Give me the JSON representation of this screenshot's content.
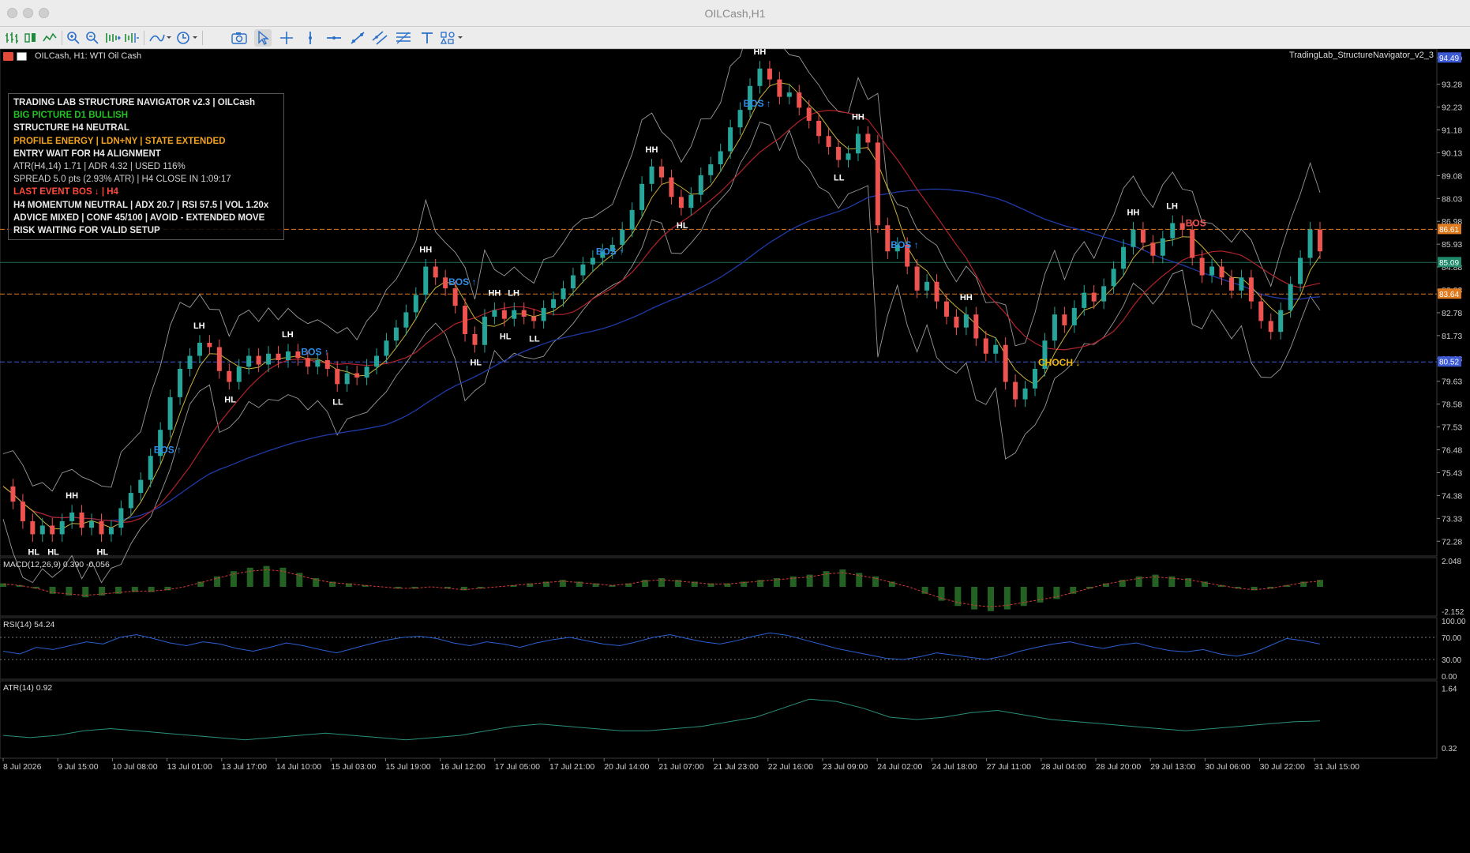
{
  "window": {
    "title": "OILCash,H1"
  },
  "toolbar": {
    "icons": [
      "chart-bars-icon",
      "candles-icon",
      "line-chart-icon",
      "zoom-in-icon",
      "zoom-out-icon",
      "autoscroll-icon",
      "chart-shift-icon",
      "indicators-icon",
      "periods-icon",
      "screenshot-icon",
      "cursor-icon",
      "crosshair-icon",
      "vertical-line-icon",
      "horizontal-line-icon",
      "trendline-icon",
      "channel-icon",
      "fibonacci-icon",
      "text-icon",
      "shapes-icon"
    ]
  },
  "chart": {
    "symbol_label": "OILCash, H1:  WTI Oil Cash",
    "indicator_name": "TradingLab_StructureNavigator_v2_3",
    "colors": {
      "bull": "#26a69a",
      "bear": "#ef5350",
      "bos": "#2f8fe8",
      "choch": "#f2b705",
      "orange_level": "#e07a1f",
      "ma_blue": "#1f3aa8",
      "ma_red": "#b2222a"
    },
    "price_axis": [
      "94.49",
      "93.28",
      "92.23",
      "91.18",
      "90.13",
      "89.08",
      "88.03",
      "86.98",
      "85.93",
      "84.88",
      "83.83",
      "82.78",
      "81.73",
      "80.68",
      "79.63",
      "78.58",
      "77.53",
      "76.48",
      "75.43",
      "74.38",
      "73.33",
      "72.28"
    ],
    "price_tags": [
      {
        "label": "94.49",
        "color": "#3d5ad6"
      },
      {
        "label": "86.61",
        "color": "#e07a1f"
      },
      {
        "label": "85.09",
        "color": "#1f8a6a"
      },
      {
        "label": "83.64",
        "color": "#e07a1f"
      },
      {
        "label": "80.52",
        "color": "#3d5ad6"
      }
    ],
    "time_axis": [
      "8 Jul 2026",
      "9 Jul 15:00",
      "10 Jul 08:00",
      "13 Jul 01:00",
      "13 Jul 17:00",
      "14 Jul 10:00",
      "15 Jul 03:00",
      "15 Jul 19:00",
      "16 Jul 12:00",
      "17 Jul 05:00",
      "17 Jul 21:00",
      "20 Jul 14:00",
      "21 Jul 07:00",
      "21 Jul 23:00",
      "22 Jul 16:00",
      "23 Jul 09:00",
      "24 Jul 02:00",
      "24 Jul 18:00",
      "27 Jul 11:00",
      "28 Jul 04:00",
      "28 Jul 20:00",
      "29 Jul 13:00",
      "30 Jul 06:00",
      "30 Jul 22:00",
      "31 Jul 15:00"
    ],
    "labels": [
      {
        "text": "HH",
        "kind": "white"
      },
      {
        "text": "LH",
        "kind": "white"
      },
      {
        "text": "LH",
        "kind": "white"
      },
      {
        "text": "HH",
        "kind": "white"
      },
      {
        "text": "HH",
        "kind": "white"
      },
      {
        "text": "LH",
        "kind": "white"
      },
      {
        "text": "HH",
        "kind": "white"
      },
      {
        "text": "HH",
        "kind": "white"
      },
      {
        "text": "HH",
        "kind": "white"
      },
      {
        "text": "HH",
        "kind": "white"
      },
      {
        "text": "HH",
        "kind": "white"
      },
      {
        "text": "LH",
        "kind": "white"
      },
      {
        "text": "HL",
        "kind": "white"
      },
      {
        "text": "HL",
        "kind": "white"
      },
      {
        "text": "HL",
        "kind": "white"
      },
      {
        "text": "HL",
        "kind": "white"
      },
      {
        "text": "LL",
        "kind": "white"
      },
      {
        "text": "HL",
        "kind": "white"
      },
      {
        "text": "HL",
        "kind": "white"
      },
      {
        "text": "LL",
        "kind": "white"
      },
      {
        "text": "HL",
        "kind": "white"
      },
      {
        "text": "LL",
        "kind": "white"
      },
      {
        "text": "BOS ↑",
        "kind": "bos"
      },
      {
        "text": "BOS ↑",
        "kind": "bos"
      },
      {
        "text": "BOS ↑",
        "kind": "bos"
      },
      {
        "text": "BOS ↑",
        "kind": "bos"
      },
      {
        "text": "BOS ↑",
        "kind": "bos"
      },
      {
        "text": "BOS ↑",
        "kind": "bos"
      },
      {
        "text": "CHOCH ↓",
        "kind": "choch"
      },
      {
        "text": "BOS",
        "kind": "bear"
      }
    ]
  },
  "dashboard": {
    "lines": [
      {
        "text": "TRADING LAB STRUCTURE NAVIGATOR v2.3  |  OILCash",
        "color": "w"
      },
      {
        "text": "BIG PICTURE D1   BULLISH",
        "color": "g"
      },
      {
        "text": "STRUCTURE   H4   NEUTRAL",
        "color": "w"
      },
      {
        "text": "PROFILE ENERGY   |   LDN+NY   |   STATE EXTENDED",
        "color": "o"
      },
      {
        "text": "ENTRY   WAIT FOR H4 ALIGNMENT",
        "color": "w"
      },
      {
        "text": "ATR(H4,14)  1.71   |   ADR  4.32   |   USED 116%",
        "color": "n"
      },
      {
        "text": "SPREAD  5.0 pts  (2.93% ATR)   |   H4 CLOSE IN  1:09:17",
        "color": "n"
      },
      {
        "text": "LAST EVENT  BOS ↓ | H4",
        "color": "r"
      },
      {
        "text": "H4 MOMENTUM NEUTRAL   | ADX 20.7 | RSI 57.5 | VOL 1.20x",
        "color": "w"
      },
      {
        "text": "ADVICE MIXED   |   CONF 45/100   |   AVOID - EXTENDED MOVE",
        "color": "w"
      },
      {
        "text": "RISK   WAITING FOR VALID SETUP",
        "color": "w"
      }
    ]
  },
  "macd": {
    "label": "MACD(12,26,9) 0.390 -0.056",
    "axis": [
      "2.048",
      "-2.152"
    ]
  },
  "rsi": {
    "label": "RSI(14) 54.24",
    "axis": [
      "100.00",
      "70.00",
      "30.00",
      "0.00"
    ]
  },
  "atr": {
    "label": "ATR(14) 0.92",
    "axis": [
      "1.64",
      "0.32"
    ]
  },
  "series_path": [
    74.8,
    74.1,
    73.2,
    72.6,
    73.0,
    72.6,
    73.2,
    73.6,
    72.9,
    73.2,
    72.6,
    72.9,
    73.8,
    74.5,
    75.1,
    76.2,
    77.4,
    78.9,
    80.2,
    80.8,
    81.4,
    81.2,
    80.1,
    79.6,
    80.3,
    80.8,
    80.4,
    80.9,
    80.6,
    81.0,
    80.7,
    80.3,
    80.6,
    80.2,
    79.5,
    80.0,
    79.8,
    80.3,
    80.8,
    81.5,
    82.1,
    82.8,
    83.6,
    84.9,
    84.4,
    83.9,
    83.1,
    81.8,
    81.3,
    82.6,
    82.9,
    82.5,
    82.9,
    82.6,
    82.4,
    83.0,
    83.4,
    83.9,
    84.5,
    85.0,
    85.3,
    85.6,
    85.9,
    86.6,
    87.5,
    88.7,
    89.5,
    89.0,
    88.1,
    87.6,
    88.2,
    89.1,
    89.6,
    90.2,
    91.3,
    92.1,
    93.2,
    94.0,
    93.5,
    92.7,
    92.9,
    92.2,
    91.6,
    90.9,
    90.4,
    89.8,
    90.1,
    91.0,
    90.6,
    86.8,
    85.6,
    85.9,
    84.9,
    83.8,
    84.2,
    83.3,
    82.6,
    82.1,
    82.7,
    81.6,
    80.9,
    81.3,
    79.6,
    78.8,
    79.3,
    80.2,
    81.5,
    82.7,
    82.2,
    83.0,
    83.7,
    83.3,
    84.0,
    84.8,
    85.8,
    86.6,
    86.0,
    85.4,
    86.2,
    86.9,
    86.6,
    85.3,
    84.5,
    84.9,
    84.4,
    83.8,
    84.4,
    83.3,
    82.4,
    81.9,
    82.9,
    84.1,
    85.3,
    86.6,
    85.6
  ],
  "macd_path": [
    0.2,
    0.1,
    -0.1,
    -0.4,
    -0.5,
    -0.6,
    -0.5,
    -0.4,
    -0.3,
    -0.3,
    -0.2,
    0.0,
    0.3,
    0.6,
    0.9,
    1.1,
    1.2,
    1.1,
    0.8,
    0.5,
    0.3,
    0.2,
    0.1,
    0.0,
    -0.1,
    -0.1,
    0.0,
    -0.1,
    -0.2,
    -0.1,
    0.0,
    0.1,
    0.2,
    0.3,
    0.4,
    0.3,
    0.2,
    0.1,
    0.2,
    0.4,
    0.5,
    0.4,
    0.3,
    0.2,
    0.2,
    0.3,
    0.4,
    0.5,
    0.6,
    0.7,
    0.9,
    1.0,
    0.8,
    0.6,
    0.3,
    0.0,
    -0.4,
    -0.8,
    -1.1,
    -1.3,
    -1.4,
    -1.3,
    -1.1,
    -0.9,
    -0.7,
    -0.4,
    -0.1,
    0.2,
    0.4,
    0.6,
    0.7,
    0.6,
    0.5,
    0.3,
    0.1,
    -0.1,
    -0.2,
    -0.1,
    0.1,
    0.3,
    0.4
  ],
  "rsi_path": [
    45,
    40,
    52,
    48,
    55,
    62,
    58,
    70,
    75,
    68,
    60,
    55,
    62,
    58,
    50,
    45,
    52,
    60,
    55,
    48,
    42,
    50,
    58,
    65,
    70,
    72,
    68,
    60,
    55,
    62,
    58,
    52,
    60,
    66,
    70,
    64,
    58,
    55,
    62,
    70,
    75,
    68,
    62,
    58,
    64,
    72,
    78,
    74,
    66,
    58,
    50,
    44,
    38,
    32,
    30,
    35,
    42,
    38,
    34,
    30,
    36,
    45,
    52,
    58,
    62,
    55,
    50,
    56,
    60,
    52,
    46,
    44,
    48,
    40,
    36,
    42,
    55,
    68,
    64,
    58
  ],
  "atr_path": [
    0.6,
    0.55,
    0.6,
    0.7,
    0.75,
    0.7,
    0.65,
    0.6,
    0.55,
    0.5,
    0.55,
    0.6,
    0.65,
    0.6,
    0.55,
    0.5,
    0.55,
    0.6,
    0.7,
    0.8,
    0.85,
    0.8,
    0.75,
    0.7,
    0.7,
    0.75,
    0.8,
    0.9,
    1.0,
    1.2,
    1.4,
    1.35,
    1.2,
    1.0,
    0.95,
    1.0,
    1.1,
    1.15,
    1.05,
    0.95,
    0.9,
    0.85,
    0.8,
    0.75,
    0.7,
    0.75,
    0.8,
    0.85,
    0.9,
    0.92
  ]
}
